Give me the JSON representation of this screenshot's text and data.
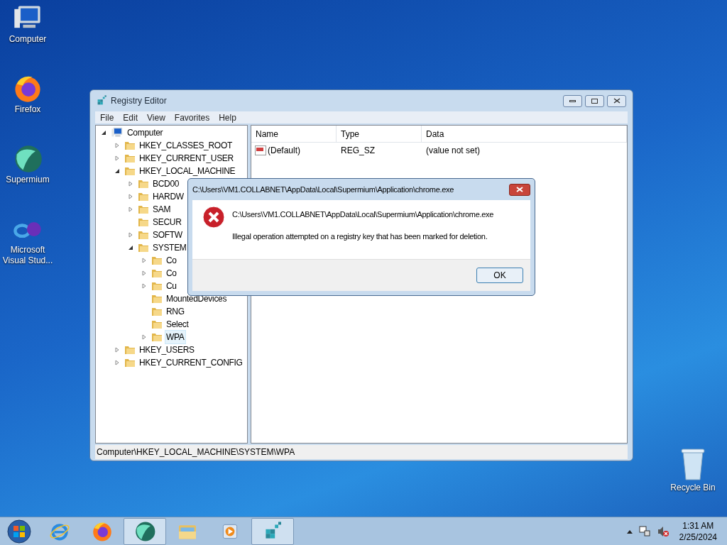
{
  "desktop_icons": [
    {
      "label": "Computer",
      "kind": "computer"
    },
    {
      "label": "Firefox",
      "kind": "firefox"
    },
    {
      "label": "Supermium",
      "kind": "supermium"
    },
    {
      "label": "Microsoft Visual Stud...",
      "kind": "vstudio"
    }
  ],
  "recycle_bin": {
    "label": "Recycle Bin"
  },
  "window": {
    "title": "Registry Editor",
    "menu": [
      "File",
      "Edit",
      "View",
      "Favorites",
      "Help"
    ],
    "tree": [
      {
        "label": "Computer",
        "kind": "computer",
        "has_children": true,
        "expanded": true,
        "selected": false,
        "children": [
          {
            "label": "HKEY_CLASSES_ROOT",
            "has_children": true,
            "expanded": false,
            "selected": false
          },
          {
            "label": "HKEY_CURRENT_USER",
            "has_children": true,
            "expanded": false,
            "selected": false
          },
          {
            "label": "HKEY_LOCAL_MACHINE",
            "has_children": true,
            "expanded": true,
            "selected": false,
            "children": [
              {
                "label": "BCD00",
                "has_children": true,
                "expanded": false,
                "selected": false
              },
              {
                "label": "HARDW",
                "has_children": true,
                "expanded": false,
                "selected": false
              },
              {
                "label": "SAM",
                "has_children": true,
                "expanded": false,
                "selected": false
              },
              {
                "label": "SECUR",
                "has_children": false,
                "selected": false
              },
              {
                "label": "SOFTW",
                "has_children": true,
                "expanded": false,
                "selected": false
              },
              {
                "label": "SYSTEM",
                "has_children": true,
                "expanded": true,
                "selected": false,
                "children": [
                  {
                    "label": "Co",
                    "has_children": true,
                    "expanded": false,
                    "selected": false
                  },
                  {
                    "label": "Co",
                    "has_children": true,
                    "expanded": false,
                    "selected": false
                  },
                  {
                    "label": "Cu",
                    "has_children": true,
                    "expanded": false,
                    "selected": false
                  },
                  {
                    "label": "MountedDevices",
                    "has_children": false,
                    "selected": false
                  },
                  {
                    "label": "RNG",
                    "has_children": false,
                    "selected": false
                  },
                  {
                    "label": "Select",
                    "has_children": false,
                    "selected": false
                  },
                  {
                    "label": "WPA",
                    "has_children": true,
                    "expanded": false,
                    "selected": true
                  }
                ]
              }
            ]
          },
          {
            "label": "HKEY_USERS",
            "has_children": true,
            "expanded": false,
            "selected": false
          },
          {
            "label": "HKEY_CURRENT_CONFIG",
            "has_children": true,
            "expanded": false,
            "selected": false
          }
        ]
      }
    ],
    "list": {
      "columns": [
        "Name",
        "Type",
        "Data"
      ],
      "rows": [
        {
          "name": "(Default)",
          "type": "REG_SZ",
          "data": "(value not set)"
        }
      ]
    },
    "status_bar": "Computer\\HKEY_LOCAL_MACHINE\\SYSTEM\\WPA"
  },
  "dialog": {
    "title": "C:\\Users\\VM1.COLLABNET\\AppData\\Local\\Supermium\\Application\\chrome.exe",
    "kind": "error",
    "lines": [
      "C:\\Users\\VM1.COLLABNET\\AppData\\Local\\Supermium\\Application\\chrome.exe",
      "Illegal operation attempted on a registry key that has been marked for deletion."
    ],
    "button": "OK"
  },
  "taskbar": {
    "apps": [
      {
        "kind": "ie",
        "highlighted": false
      },
      {
        "kind": "firefox",
        "highlighted": false
      },
      {
        "kind": "supermium",
        "highlighted": true
      },
      {
        "kind": "explorer",
        "highlighted": false
      },
      {
        "kind": "media",
        "highlighted": false
      },
      {
        "kind": "regedit",
        "highlighted": true
      }
    ],
    "time": "1:31 AM",
    "date": "2/25/2024"
  }
}
